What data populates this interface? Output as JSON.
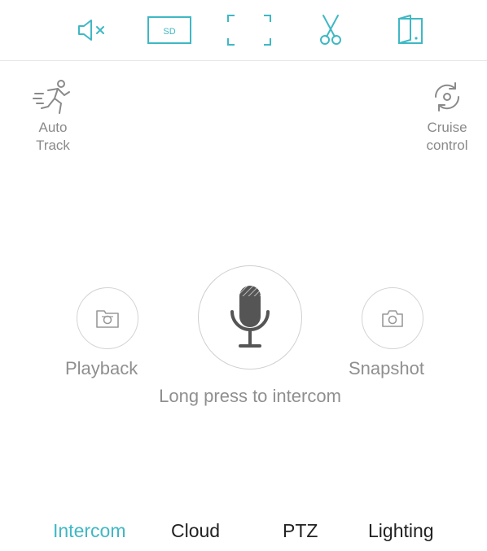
{
  "colors": {
    "accent": "#3fb8c4",
    "icon_gray": "#8a8a8a",
    "text_dark": "#222222"
  },
  "toolbar": {
    "mute": {
      "icon": "speaker-muted-icon"
    },
    "quality": {
      "icon": "sd-quality-icon",
      "label": "SD"
    },
    "fullscreen": {
      "icon": "fullscreen-icon"
    },
    "clip": {
      "icon": "scissors-icon"
    },
    "door": {
      "icon": "door-icon"
    }
  },
  "side": {
    "auto_track": {
      "label": "Auto\nTrack",
      "icon": "running-man-icon"
    },
    "cruise": {
      "label": "Cruise\ncontrol",
      "icon": "rotate-cycle-icon"
    }
  },
  "controls": {
    "playback": {
      "label": "Playback",
      "icon": "playback-folder-icon"
    },
    "snapshot": {
      "label": "Snapshot",
      "icon": "camera-icon"
    },
    "mic": {
      "icon": "microphone-icon"
    },
    "hint": "Long press to intercom"
  },
  "tabs": [
    {
      "label": "Intercom",
      "active": true
    },
    {
      "label": "Cloud",
      "active": false
    },
    {
      "label": "PTZ",
      "active": false
    },
    {
      "label": "Lighting",
      "active": false
    }
  ]
}
